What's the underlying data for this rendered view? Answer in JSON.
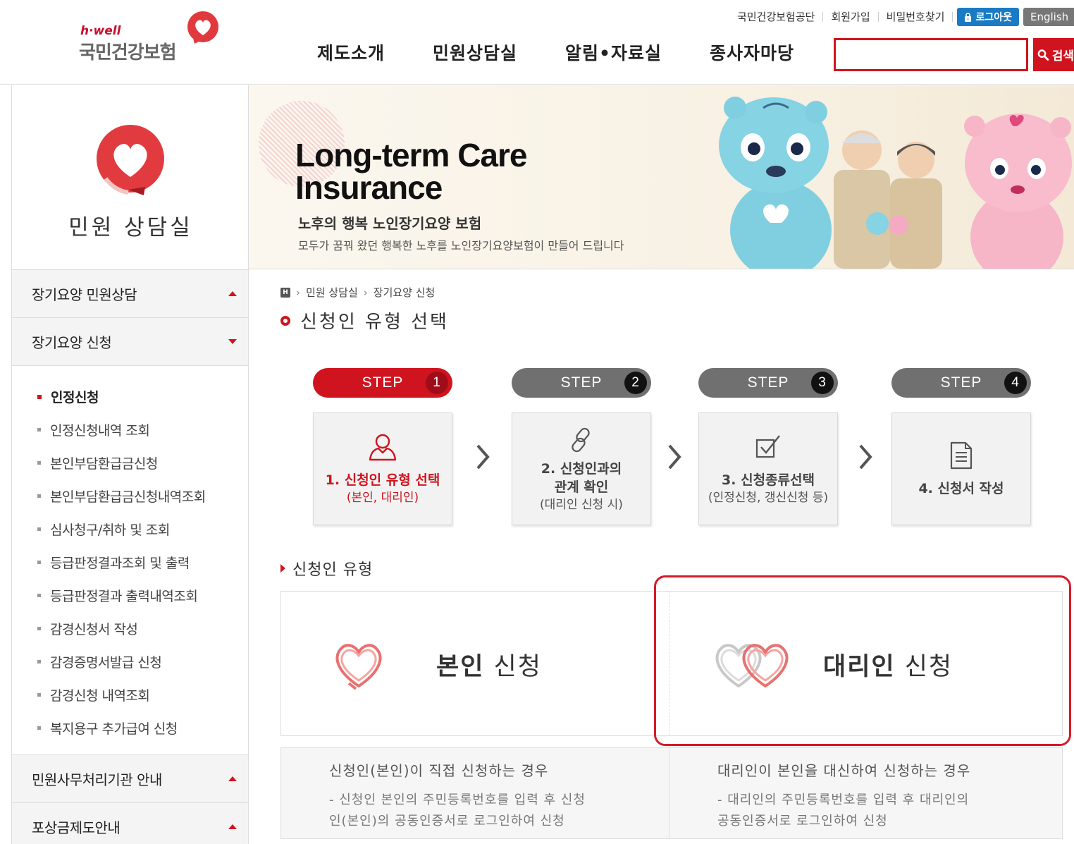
{
  "header": {
    "logo_tag": "h·well",
    "logo_name": "국민건강보험",
    "util_links": [
      "국민건강보험공단",
      "회원가입",
      "비밀번호찾기"
    ],
    "logout_label": "로그아웃",
    "english_label": "English",
    "gnb": [
      "제도소개",
      "민원상담실",
      "알림•자료실",
      "종사자마당"
    ],
    "search_value": "",
    "search_button": "검색"
  },
  "sidebar": {
    "title": "민원 상담실",
    "menus": [
      {
        "label": "장기요양 민원상담",
        "state": "collapsed"
      },
      {
        "label": "장기요양 신청",
        "state": "expanded"
      }
    ],
    "sub_items": [
      "인정신청",
      "인정신청내역 조회",
      "본인부담환급금신청",
      "본인부담환급금신청내역조회",
      "심사청구/취하 및 조회",
      "등급판정결과조회 및 출력",
      "등급판정결과 출력내역조회",
      "감경신청서 작성",
      "감경증명서발급 신청",
      "감경신청 내역조회",
      "복지용구 추가급여 신청"
    ],
    "active_sub": "인정신청",
    "bottom_menus": [
      {
        "label": "민원사무처리기관 안내",
        "state": "collapsed"
      },
      {
        "label": "포상금제도안내",
        "state": "collapsed"
      }
    ]
  },
  "banner": {
    "title_line1": "Long-term Care",
    "title_line2": "Insurance",
    "subtitle": "노후의 행복 노인장기요양 보험",
    "description": "모두가 꿈꿔 왔던 행복한 노후를 노인장기요양보험이 만들어 드립니다"
  },
  "breadcrumb": {
    "home_icon": "H",
    "items": [
      "민원 상담실",
      "장기요양 신청"
    ]
  },
  "page_title": "신청인 유형 선택",
  "steps": [
    {
      "pill": "STEP",
      "num": "1",
      "label": "1. 신청인 유형 선택",
      "note": "(본인, 대리인)",
      "icon": "person-icon",
      "active": true
    },
    {
      "pill": "STEP",
      "num": "2",
      "label_line1": "2. 신청인과의",
      "label_line2": "관계 확인",
      "note": "(대리인 신청 시)",
      "icon": "link-icon",
      "active": false
    },
    {
      "pill": "STEP",
      "num": "3",
      "label": "3. 신청종류선택",
      "note": "(인정신청, 갱신신청 등)",
      "icon": "checkbox-icon",
      "active": false
    },
    {
      "pill": "STEP",
      "num": "4",
      "label": "4. 신청서 작성",
      "icon": "document-icon",
      "active": false
    }
  ],
  "section_title": "신청인 유형",
  "choices": {
    "self": {
      "bold": "본인",
      "rest": " 신청"
    },
    "proxy": {
      "bold": "대리인",
      "rest": " 신청"
    }
  },
  "descriptions": {
    "self": {
      "head": "신청인(본인)이 직접 신청하는 경우",
      "line1": " - 신청인 본인의 주민등록번호를 입력 후 신청",
      "line2": "인(본인)의 공동인증서로 로그인하여 신청"
    },
    "proxy": {
      "head": "대리인이 본인을 대신하여 신청하는 경우",
      "line1": " - 대리인의 주민등록번호를 입력 후 대리인의",
      "line2": "공동인증서로 로그인하여 신청"
    }
  },
  "colors": {
    "brand_red": "#d0141f",
    "logout_blue": "#1a7bc4",
    "step_gray": "#707070"
  }
}
